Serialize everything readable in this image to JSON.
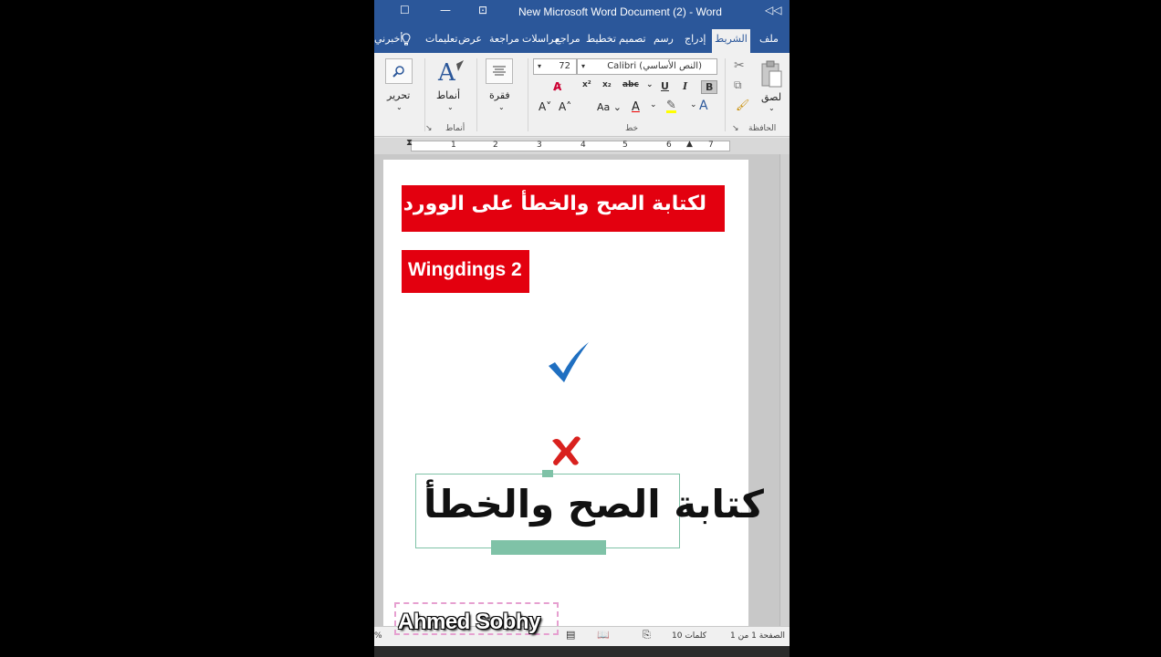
{
  "window": {
    "title": "New Microsoft Word Document (2)  -  Word",
    "controls": [
      "◁◁",
      "⊡",
      "—",
      "☐"
    ]
  },
  "tabs": [
    {
      "label": "ملف"
    },
    {
      "label": "الشريط"
    },
    {
      "label": "إدراج"
    },
    {
      "label": "رسم"
    },
    {
      "label": "تصميم"
    },
    {
      "label": "تخطيط"
    },
    {
      "label": "مراجع"
    },
    {
      "label": "مراسلات"
    },
    {
      "label": "مراجعة"
    },
    {
      "label": "عرض"
    },
    {
      "label": "تعليمات"
    },
    {
      "label": "أخبرني"
    }
  ],
  "ribbon": {
    "clipboard": {
      "paste": "لصق",
      "group_label": "الحافظة"
    },
    "font": {
      "family": "Calibri (النص الأساسي)",
      "size": "72",
      "bold": "B",
      "italic": "I",
      "underline": "U",
      "strike": "abc",
      "subscript": "x₂",
      "superscript": "x²",
      "group_label": "خط"
    },
    "paragraph": {
      "label": "فقرة"
    },
    "styles": {
      "label": "أنماط",
      "group_label": "أنماط"
    },
    "editing": {
      "label": "تحرير"
    }
  },
  "ruler": {
    "numbers": [
      "1",
      "2",
      "3",
      "4",
      "5",
      "6",
      "7"
    ]
  },
  "document": {
    "banner1": "لكتابة الصح والخطأ على الوورد",
    "banner2": "Wingdings 2",
    "check_color": "#1f6fc1",
    "cross_color": "#d9211e",
    "textbox_text": "كتابة الصح والخطأ"
  },
  "watermark": "Ahmed Sobhy",
  "statusbar": {
    "page": "الصفحة 1 من 1",
    "words": "10 كلمات",
    "zoom": "%"
  }
}
